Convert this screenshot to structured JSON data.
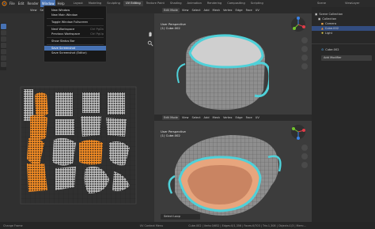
{
  "topbar": {
    "menus": [
      "File",
      "Edit",
      "Render",
      "Window",
      "Help"
    ],
    "workspaces": [
      "Layout",
      "Modeling",
      "Sculpting",
      "UV Editing",
      "Texture Paint",
      "Shading",
      "Animation",
      "Rendering",
      "Compositing",
      "Scripting"
    ],
    "active_workspace": "UV Editing",
    "scene_label": "Scene",
    "viewlayer_label": "ViewLayer"
  },
  "window_menu": {
    "items": [
      {
        "label": "New Window",
        "shortcut": ""
      },
      {
        "label": "New Main Window",
        "shortcut": ""
      },
      {
        "label": "Toggle Window Fullscreen",
        "shortcut": ""
      },
      {
        "label": "Next Workspace",
        "shortcut": "Ctrl PgDn"
      },
      {
        "label": "Previous Workspace",
        "shortcut": "Ctrl PgUp"
      },
      {
        "label": "Show Status Bar",
        "shortcut": ""
      },
      {
        "label": "Save Screenshot",
        "shortcut": ""
      },
      {
        "label": "Save Screenshot (Editor)",
        "shortcut": ""
      }
    ],
    "highlighted": "Save Screenshot"
  },
  "uv_editor": {
    "image_name": "Untitled.0",
    "menus": [
      "View",
      "Select",
      "Image",
      "UV"
    ]
  },
  "viewport_top": {
    "mode": "Edit Mode",
    "menus": [
      "View",
      "Select",
      "Add",
      "Mesh",
      "Vertex",
      "Edge",
      "Face",
      "UV"
    ],
    "label1": "User Perspective",
    "label2": "(1) Cube.002"
  },
  "viewport_bottom": {
    "mode": "Edit Mode",
    "menus": [
      "View",
      "Select",
      "Add",
      "Mesh",
      "Vertex",
      "Edge",
      "Face",
      "UV"
    ],
    "label1": "User Perspective",
    "label2": "(1) Cube.002",
    "operator_panel": "Select Loop"
  },
  "outliner": {
    "rows": [
      {
        "label": "Scene Collection",
        "selected": false
      },
      {
        "label": "Collection",
        "selected": false
      },
      {
        "label": "Camera",
        "selected": false
      },
      {
        "label": "Cube.002",
        "selected": true
      },
      {
        "label": "Light",
        "selected": false
      }
    ]
  },
  "properties": {
    "object_name": "Cube.002",
    "add_modifier": "Add Modifier"
  },
  "statusbar": {
    "left": "Change Frame",
    "middle": "UV Context Menu",
    "right": "Cube.002 | Verts:0/652 | Edges:0/1,356 | Faces:0/703 | Tris:1,308 | Objects:1/3 | Mem:..."
  },
  "colors": {
    "accent": "#4772b3",
    "orange": "#f08a24",
    "teal": "#4fd1d9",
    "mesh": "#8a8a8a"
  }
}
